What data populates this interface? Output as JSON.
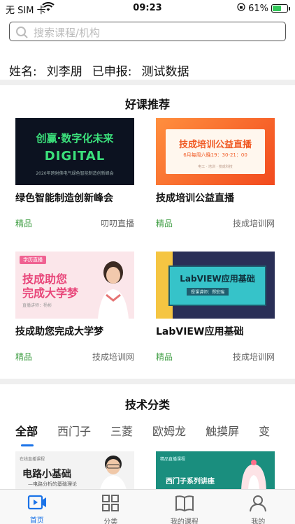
{
  "status_bar": {
    "carrier": "无 SIM 卡",
    "time": "09:23",
    "battery": "61%",
    "battery_level": 0.61
  },
  "search": {
    "placeholder": "搜索课程/机构"
  },
  "profile": {
    "name_label": "姓名:",
    "name_value": "刘李朋",
    "applied_label": "已申报:",
    "applied_value": "测试数据"
  },
  "recommended": {
    "title": "好课推荐",
    "courses": [
      {
        "name": "绿色智能制造创新峰会",
        "tag": "精品",
        "source": "叨叨直播",
        "thumb_text": [
          "创赢·数字化未来",
          "DIGITAL",
          "2020年跨射佛电气绿色智能制造创新峰会"
        ]
      },
      {
        "name": "技成培训公益直播",
        "tag": "精品",
        "source": "技成培训网",
        "thumb_text": [
          "技成培训公益直播",
          "6月每周六晚19：30-21：00",
          "电工 · 培训 · 技成科技"
        ]
      },
      {
        "name": "技成助您完成大学梦",
        "tag": "精品",
        "source": "技成培训网",
        "thumb_text": [
          "学历直播",
          "技成助您",
          "完成大学梦",
          "直播讲师：杨彬"
        ]
      },
      {
        "name": "LabVIEW应用基础",
        "tag": "精品",
        "source": "技成培训网",
        "thumb_text": [
          "LabVIEW应用基础",
          "授课讲师：郑宏瑞"
        ]
      }
    ]
  },
  "tech": {
    "title": "技术分类",
    "tabs": [
      "全部",
      "西门子",
      "三菱",
      "欧姆龙",
      "触摸屏",
      "变"
    ],
    "active_tab": 0,
    "preview_cards": [
      {
        "badge": "在线直播课程",
        "title": "电路小基础",
        "subtitle": "—电路分析的基础理论"
      },
      {
        "badge": "精品直播课程",
        "title": "西门子系列讲座"
      }
    ]
  },
  "tabbar": {
    "items": [
      {
        "label": "首页",
        "icon": "video-home-icon",
        "active": true
      },
      {
        "label": "分类",
        "icon": "grid-icon",
        "active": false
      },
      {
        "label": "我的课程",
        "icon": "book-icon",
        "active": false
      },
      {
        "label": "我的",
        "icon": "user-icon",
        "active": false
      }
    ]
  },
  "colors": {
    "accent": "#1b73e8",
    "tag_green": "#43a047",
    "divider": "#efefef"
  }
}
